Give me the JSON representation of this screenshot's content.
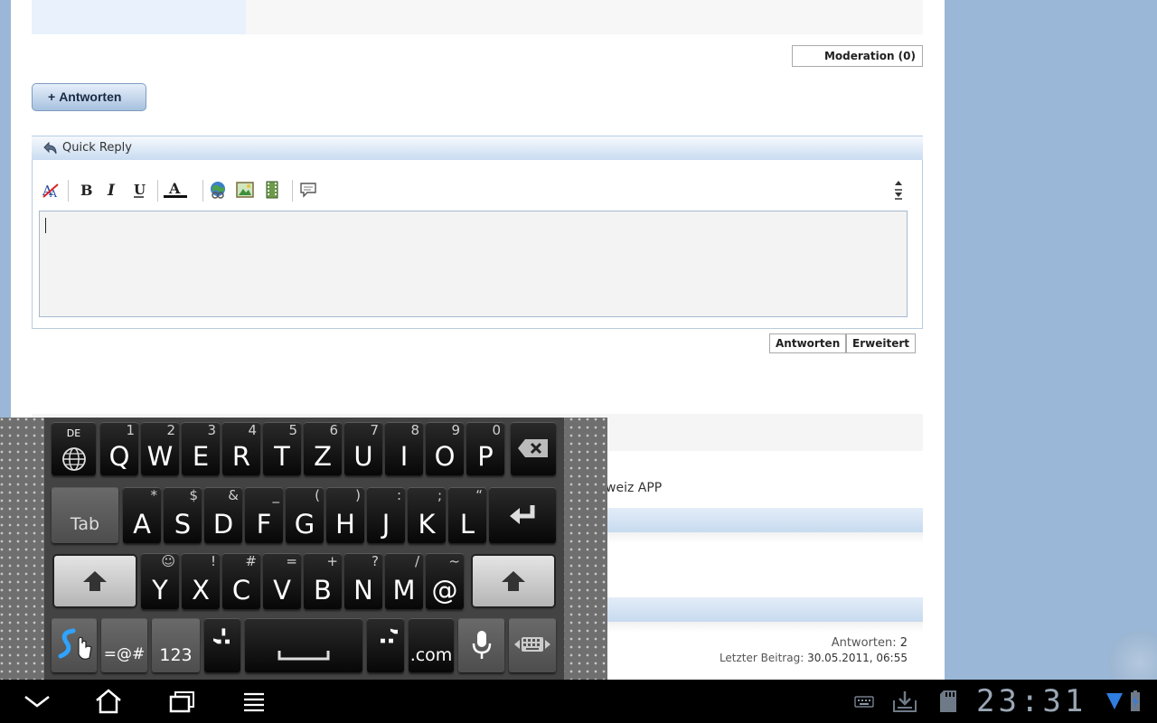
{
  "page": {
    "moderation_label": "Moderation (0)",
    "reply_button_plus": "+",
    "reply_button_label": "Antworten",
    "quick_reply_title": "Quick Reply",
    "editor_toolbar": [
      "remove-format",
      "bold",
      "italic",
      "underline",
      "font-color",
      "insert-link",
      "insert-image",
      "insert-video",
      "quote",
      "resize"
    ],
    "editor_text": "",
    "submit_label": "Antworten",
    "advanced_label": "Erweitert",
    "partial_thread_title": "weiz APP",
    "thread_stats": {
      "replies_label": "Antworten:",
      "replies_value": "2",
      "last_post_label": "Letzter Beitrag:",
      "last_post_value": "30.05.2011, 06:55"
    }
  },
  "keyboard": {
    "lang_label": "DE",
    "row1": [
      {
        "k": "Q",
        "s": "1"
      },
      {
        "k": "W",
        "s": "2"
      },
      {
        "k": "E",
        "s": "3"
      },
      {
        "k": "R",
        "s": "4"
      },
      {
        "k": "T",
        "s": "5"
      },
      {
        "k": "Z",
        "s": "6"
      },
      {
        "k": "U",
        "s": "7"
      },
      {
        "k": "I",
        "s": "8"
      },
      {
        "k": "O",
        "s": "9"
      },
      {
        "k": "P",
        "s": "0"
      }
    ],
    "row2": [
      {
        "k": "A",
        "s": "*"
      },
      {
        "k": "S",
        "s": "$"
      },
      {
        "k": "D",
        "s": "&"
      },
      {
        "k": "F",
        "s": "_"
      },
      {
        "k": "G",
        "s": "("
      },
      {
        "k": "H",
        "s": ")"
      },
      {
        "k": "J",
        "s": ":"
      },
      {
        "k": "K",
        "s": ";"
      },
      {
        "k": "L",
        "s": "“"
      }
    ],
    "row3": [
      {
        "k": "Y",
        "s": "☺"
      },
      {
        "k": "X",
        "s": "!"
      },
      {
        "k": "C",
        "s": "#"
      },
      {
        "k": "V",
        "s": "="
      },
      {
        "k": "B",
        "s": "+"
      },
      {
        "k": "N",
        "s": "?"
      },
      {
        "k": "M",
        "s": "/"
      },
      {
        "k": "@",
        "s": "~"
      }
    ],
    "tab_label": "Tab",
    "symbols_label": "=@#",
    "numbers_label": "123",
    "semicolon_label": "-;",
    "colon_label": "’:",
    "dotcom_label": ".com"
  },
  "system_bar": {
    "clock": "23:31",
    "accent_color": "#9aa6b5"
  }
}
